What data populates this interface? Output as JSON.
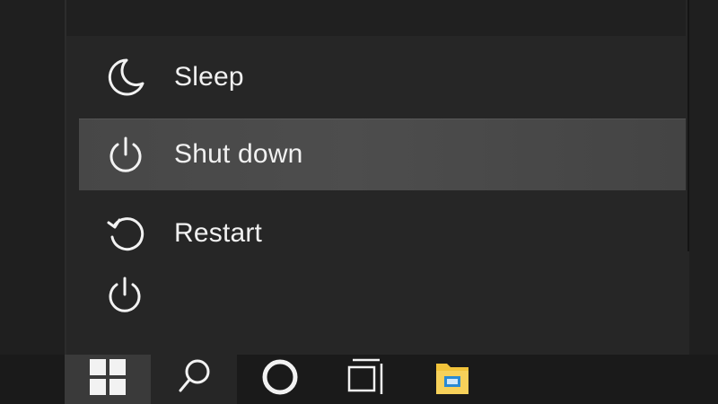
{
  "power_menu": {
    "items": [
      {
        "label": "Sleep",
        "icon": "moon-icon"
      },
      {
        "label": "Shut down",
        "icon": "power-icon",
        "selected": true
      },
      {
        "label": "Restart",
        "icon": "restart-icon"
      }
    ]
  },
  "start_menu": {
    "power_button_icon": "power-icon"
  },
  "taskbar": {
    "items": [
      {
        "icon": "windows-logo-icon"
      },
      {
        "icon": "search-icon"
      },
      {
        "icon": "cortana-icon"
      },
      {
        "icon": "task-view-icon"
      },
      {
        "icon": "file-explorer-icon"
      }
    ]
  },
  "colors": {
    "menu_bg": "#262626",
    "selected_bg": "#4a4a4a",
    "taskbar_bg": "#1a1a1a",
    "start_button_bg": "#3a3a3a",
    "folder_yellow": "#f2c33a",
    "folder_blue": "#2a8ad4"
  }
}
